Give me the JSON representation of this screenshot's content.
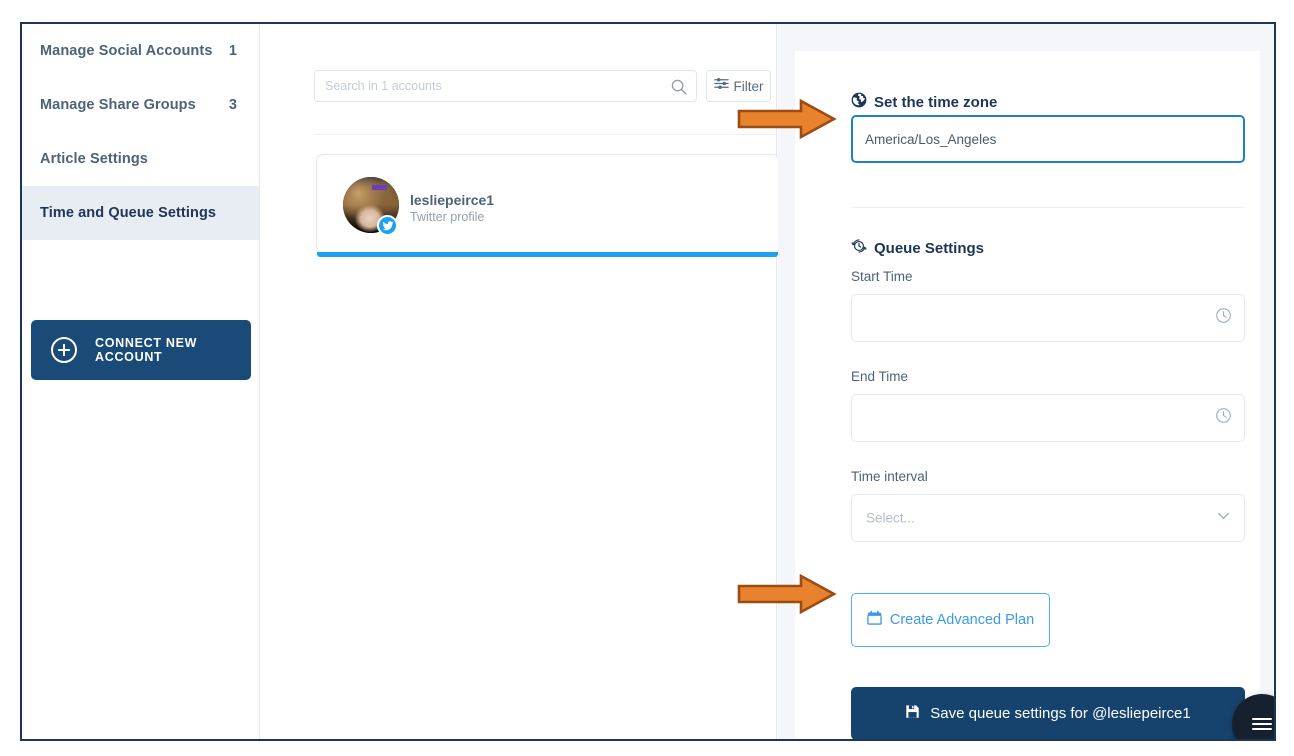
{
  "sidebar": {
    "items": [
      {
        "name": "manage-social-accounts",
        "label": "Manage Social Accounts",
        "count": "1",
        "active": false
      },
      {
        "name": "manage-share-groups",
        "label": "Manage Share Groups",
        "count": "3",
        "active": false
      },
      {
        "name": "article-settings",
        "label": "Article Settings",
        "count": "",
        "active": false
      },
      {
        "name": "time-and-queue-settings",
        "label": "Time and Queue Settings",
        "count": "",
        "active": true
      }
    ],
    "connect_button": {
      "label": "CONNECT NEW ACCOUNT",
      "icon": "plus-circle-icon"
    }
  },
  "accounts_panel": {
    "search": {
      "placeholder": "Search in 1 accounts",
      "value": "",
      "icon": "search-icon"
    },
    "filter_button": {
      "label": "Filter",
      "icon": "sliders-icon"
    },
    "cards": [
      {
        "name": "lesliepeirce1",
        "subtitle": "Twitter profile",
        "network": "twitter",
        "accent_color": "#1da1f2"
      }
    ]
  },
  "settings_panel": {
    "timezone": {
      "heading": "Set the time zone",
      "icon": "globe-icon",
      "value": "America/Los_Angeles",
      "placeholder": ""
    },
    "queue": {
      "heading": "Queue Settings",
      "icon": "clock-sync-icon",
      "start_time": {
        "label": "Start Time",
        "value": "",
        "icon": "clock-icon"
      },
      "end_time": {
        "label": "End Time",
        "value": "",
        "icon": "clock-icon"
      },
      "time_interval": {
        "label": "Time interval",
        "value": "Select...",
        "icon": "chevron-down-icon"
      }
    },
    "advanced_plan_button": {
      "label": "Create Advanced Plan",
      "icon": "calendar-icon"
    },
    "save_button": {
      "label": "Save queue settings for @lesliepeirce1",
      "icon": "save-disk-icon"
    }
  },
  "fab": {
    "name": "menu-fab",
    "icon": "hamburger-menu-icon"
  },
  "annotations": [
    {
      "name": "arrow-to-timezone-input",
      "target": "timezone-input",
      "color": "#e07b2a"
    },
    {
      "name": "arrow-to-advanced-plan",
      "target": "advanced-plan-button",
      "color": "#e07b2a"
    }
  ],
  "colors": {
    "frame_border": "#1d3557",
    "navy": "#1d3557",
    "primary_dark": "#16436e",
    "accent_blue": "#1da1f2",
    "link_blue": "#3a9ae8",
    "focus_blue": "#1b7fd4",
    "panel_bg": "#f4f6fa",
    "arrow_orange": "#e07b2a"
  }
}
